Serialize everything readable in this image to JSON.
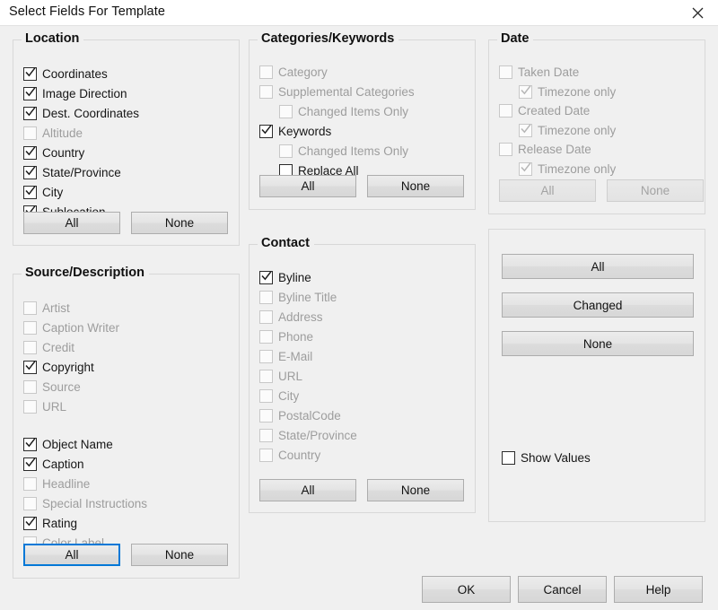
{
  "window": {
    "title": "Select Fields For Template",
    "close_icon": "close-icon"
  },
  "groups": {
    "location": {
      "title": "Location",
      "items": [
        {
          "label": "Coordinates",
          "checked": true,
          "enabled": true
        },
        {
          "label": "Image Direction",
          "checked": true,
          "enabled": true
        },
        {
          "label": "Dest. Coordinates",
          "checked": true,
          "enabled": true
        },
        {
          "label": "Altitude",
          "checked": false,
          "enabled": false
        },
        {
          "label": "Country",
          "checked": true,
          "enabled": true
        },
        {
          "label": "State/Province",
          "checked": true,
          "enabled": true
        },
        {
          "label": "City",
          "checked": true,
          "enabled": true
        },
        {
          "label": "Sublocation",
          "checked": true,
          "enabled": true
        }
      ],
      "all_label": "All",
      "none_label": "None"
    },
    "source_description": {
      "title": "Source/Description",
      "items": [
        {
          "label": "Artist",
          "checked": false,
          "enabled": false
        },
        {
          "label": "Caption Writer",
          "checked": false,
          "enabled": false
        },
        {
          "label": "Credit",
          "checked": false,
          "enabled": false
        },
        {
          "label": "Copyright",
          "checked": true,
          "enabled": true
        },
        {
          "label": "Source",
          "checked": false,
          "enabled": false
        },
        {
          "label": "URL",
          "checked": false,
          "enabled": false
        },
        {
          "label": "Object Name",
          "checked": true,
          "enabled": true
        },
        {
          "label": "Caption",
          "checked": true,
          "enabled": true
        },
        {
          "label": "Headline",
          "checked": false,
          "enabled": false
        },
        {
          "label": "Special Instructions",
          "checked": false,
          "enabled": false
        },
        {
          "label": "Rating",
          "checked": true,
          "enabled": true
        },
        {
          "label": "Color Label",
          "checked": false,
          "enabled": false
        }
      ],
      "all_label": "All",
      "none_label": "None"
    },
    "categories_keywords": {
      "title": "Categories/Keywords",
      "items": [
        {
          "label": "Category",
          "checked": false,
          "enabled": false,
          "indent": 0
        },
        {
          "label": "Supplemental Categories",
          "checked": false,
          "enabled": false,
          "indent": 0
        },
        {
          "label": "Changed Items Only",
          "checked": false,
          "enabled": false,
          "indent": 1
        },
        {
          "label": "Keywords",
          "checked": true,
          "enabled": true,
          "indent": 0
        },
        {
          "label": "Changed Items Only",
          "checked": false,
          "enabled": false,
          "indent": 1
        },
        {
          "label": "Replace All",
          "checked": false,
          "enabled": true,
          "indent": 1
        }
      ],
      "all_label": "All",
      "none_label": "None"
    },
    "contact": {
      "title": "Contact",
      "items": [
        {
          "label": "Byline",
          "checked": true,
          "enabled": true
        },
        {
          "label": "Byline Title",
          "checked": false,
          "enabled": false
        },
        {
          "label": "Address",
          "checked": false,
          "enabled": false
        },
        {
          "label": "Phone",
          "checked": false,
          "enabled": false
        },
        {
          "label": "E-Mail",
          "checked": false,
          "enabled": false
        },
        {
          "label": "URL",
          "checked": false,
          "enabled": false
        },
        {
          "label": "City",
          "checked": false,
          "enabled": false
        },
        {
          "label": "PostalCode",
          "checked": false,
          "enabled": false
        },
        {
          "label": "State/Province",
          "checked": false,
          "enabled": false
        },
        {
          "label": "Country",
          "checked": false,
          "enabled": false
        }
      ],
      "all_label": "All",
      "none_label": "None"
    },
    "date": {
      "title": "Date",
      "items": [
        {
          "label": "Taken Date",
          "checked": false,
          "enabled": false,
          "indent": 0
        },
        {
          "label": "Timezone only",
          "checked": true,
          "enabled": false,
          "indent": 1
        },
        {
          "label": "Created Date",
          "checked": false,
          "enabled": false,
          "indent": 0
        },
        {
          "label": "Timezone only",
          "checked": true,
          "enabled": false,
          "indent": 1
        },
        {
          "label": "Release Date",
          "checked": false,
          "enabled": false,
          "indent": 0
        },
        {
          "label": "Timezone only",
          "checked": true,
          "enabled": false,
          "indent": 1
        }
      ],
      "all_label": "All",
      "none_label": "None",
      "all_enabled": false,
      "none_enabled": false
    },
    "global": {
      "all_label": "All",
      "changed_label": "Changed",
      "none_label": "None",
      "show_values": {
        "label": "Show Values",
        "checked": false,
        "enabled": true
      }
    }
  },
  "footer": {
    "ok_label": "OK",
    "cancel_label": "Cancel",
    "help_label": "Help"
  },
  "colors": {
    "dialog_bg": "#f0f0f0",
    "focus_accent": "#0078d7",
    "disabled_text": "#9d9d9d",
    "text": "#161616"
  }
}
